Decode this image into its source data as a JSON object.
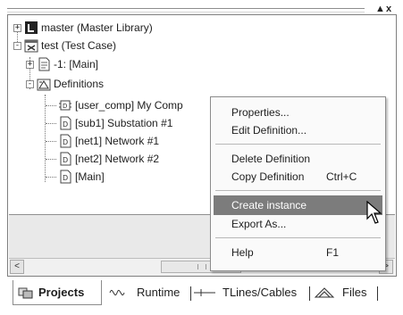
{
  "window": {
    "pin_glyph": "▲",
    "close_glyph": "x"
  },
  "tree": {
    "nodes": [
      {
        "label": "master (Master Library)",
        "expander": "+",
        "icon": "library-icon"
      },
      {
        "label": "test (Test Case)",
        "expander": "-",
        "icon": "test-case-icon"
      },
      {
        "label": "-1: [Main]",
        "expander": "+",
        "icon": "page-icon"
      },
      {
        "label": "Definitions",
        "expander": "-",
        "icon": "definitions-icon"
      },
      {
        "label": "[user_comp] My Comp",
        "icon": "component-icon"
      },
      {
        "label": "[sub1] Substation #1",
        "icon": "definition-icon"
      },
      {
        "label": "[net1] Network #1",
        "icon": "definition-icon"
      },
      {
        "label": "[net2] Network #2",
        "icon": "definition-icon"
      },
      {
        "label": "[Main]",
        "icon": "definition-icon"
      }
    ]
  },
  "scrollbar": {
    "left_arrow": "<",
    "right_arrow": ">"
  },
  "context_menu": {
    "items": [
      {
        "label": "Properties...",
        "shortcut": ""
      },
      {
        "label": "Edit Definition...",
        "shortcut": ""
      },
      {
        "label": "Delete Definition",
        "shortcut": ""
      },
      {
        "label": "Copy Definition",
        "shortcut": "Ctrl+C"
      },
      {
        "label": "Create instance",
        "shortcut": "",
        "highlighted": true
      },
      {
        "label": "Export As...",
        "shortcut": ""
      },
      {
        "label": "Help",
        "shortcut": "F1"
      }
    ]
  },
  "tabs": [
    {
      "label": "Projects",
      "active": true,
      "icon": "projects-icon"
    },
    {
      "label": "Runtime",
      "active": false,
      "icon": "waveform-icon"
    },
    {
      "label": "TLines/Cables",
      "active": false,
      "icon": "tline-icon"
    },
    {
      "label": "Files",
      "active": false,
      "icon": "files-icon"
    }
  ],
  "colors": {
    "menu_highlight": "#7c7c7c",
    "panel_grey": "#e9e9e9",
    "border": "#7f7f7f"
  }
}
